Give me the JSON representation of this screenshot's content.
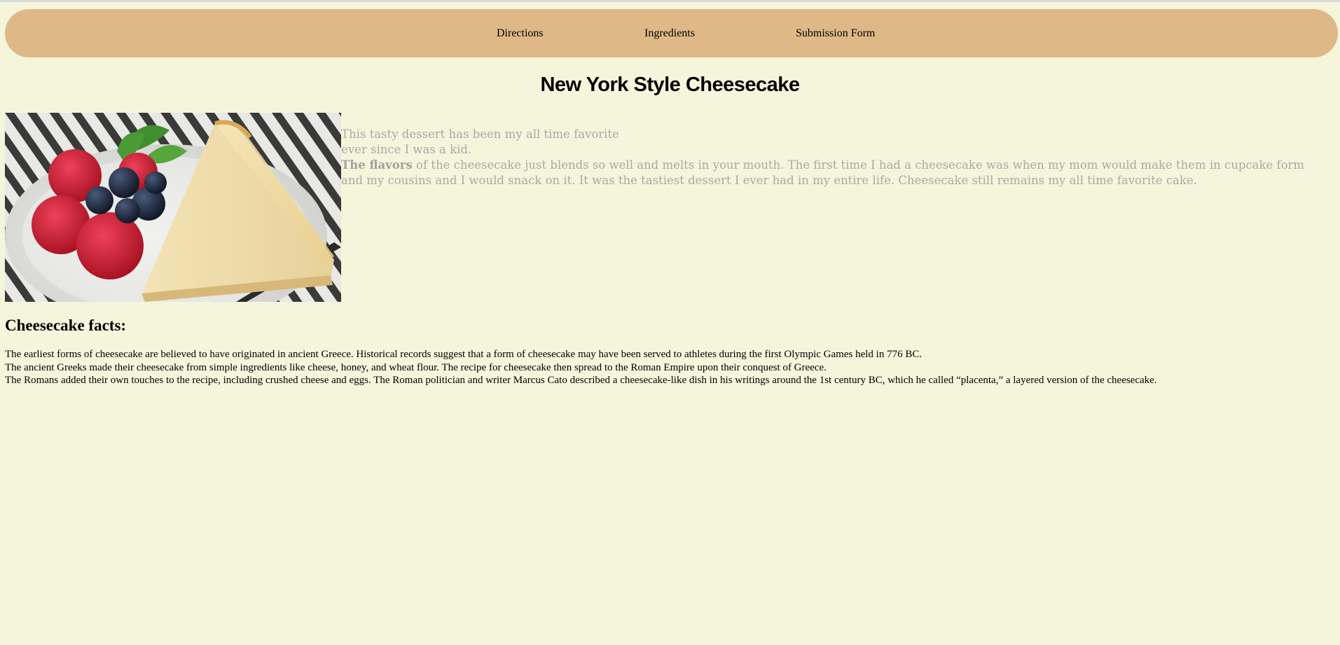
{
  "nav": {
    "links": [
      "Directions",
      "Ingredients",
      "Submission Form"
    ]
  },
  "page": {
    "title": "New York Style Cheesecake"
  },
  "intro": {
    "line1": "This tasty dessert has been my all time favorite",
    "line2": "ever since I was a kid.",
    "bold_lead": "The flavors",
    "rest": " of the cheesecake just blends so well and melts in your mouth. The first time I had a cheesecake was when my mom would make them in cupcake form and my cousins and I would snack on it. It was the tastiest dessert I ever had in my entire life. Cheesecake still remains my all time favorite cake."
  },
  "facts": {
    "heading": "Cheesecake facts:",
    "lines": [
      "The earliest forms of cheesecake are believed to have originated in ancient Greece. Historical records suggest that a form of cheesecake may have been served to athletes during the first Olympic Games held in 776 BC.",
      "The ancient Greeks made their cheesecake from simple ingredients like cheese, honey, and wheat flour. The recipe for cheesecake then spread to the Roman Empire upon their conquest of Greece.",
      "The Romans added their own touches to the recipe, including crushed cheese and eggs. The Roman politician and writer Marcus Cato described a cheesecake-like dish in his writings around the 1st century BC, which he called “placenta,” a layered version of the cheesecake."
    ]
  },
  "colors": {
    "background": "#f5f5dc",
    "nav_background": "#deb887",
    "intro_text": "#a9a9a9"
  }
}
